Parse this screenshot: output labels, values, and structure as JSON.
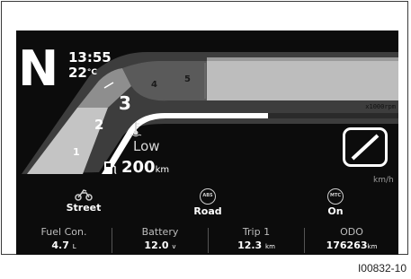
{
  "display": {
    "gear": "N",
    "time": "13:55",
    "temperature": {
      "value": "22",
      "unit": "°C"
    },
    "rpm_unit": "x1000rpm",
    "rpm_scale": [
      "1",
      "2",
      "3",
      "4",
      "5"
    ],
    "highlighted_rpm_mark": "3",
    "coolant_label": "Low",
    "range": {
      "value": "200",
      "unit": "km"
    },
    "speed_unit": "km/h"
  },
  "modes": [
    {
      "icon": "motorcycle-icon",
      "label": "Street"
    },
    {
      "icon": "abs-icon",
      "icon_text": "ABS",
      "label": "Road"
    },
    {
      "icon": "mtc-icon",
      "icon_text": "MTC",
      "label": "On"
    }
  ],
  "info": [
    {
      "title": "Fuel Con.",
      "value": "4.7",
      "unit": "L"
    },
    {
      "title": "Battery",
      "value": "12.0",
      "unit": "v"
    },
    {
      "title": "Trip 1",
      "value": "12.3",
      "unit": "km"
    },
    {
      "title": "ODO",
      "value": "176263",
      "unit": "km"
    }
  ],
  "figure_ref": "I00832-10",
  "colors": {
    "background": "#0c0c0c",
    "rpm_band_light": "#bdbdbd",
    "rpm_band_mid": "#8a8a8a",
    "rpm_band_dark": "#4a4a4a",
    "text": "#ffffff"
  }
}
